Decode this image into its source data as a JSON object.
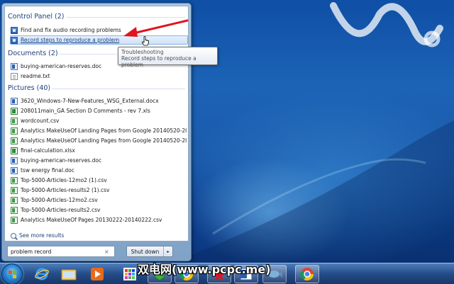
{
  "colors": {
    "accent": "#1e3f79",
    "selection": "#cde2f8",
    "annotation_arrow": "#e0141e"
  },
  "start_menu": {
    "groups": [
      {
        "header": "Control Panel (2)",
        "items": [
          {
            "label": "Find and fix audio recording problems",
            "icon": "control-panel-icon",
            "selected": false
          },
          {
            "label": "Record steps to reproduce a problem",
            "icon": "control-panel-icon",
            "selected": true
          }
        ]
      },
      {
        "header": "Documents (2)",
        "items": [
          {
            "label": "buying-american-reserves.doc",
            "icon": "word-doc-icon"
          },
          {
            "label": "readme.txt",
            "icon": "text-file-icon"
          }
        ]
      },
      {
        "header": "Pictures (40)",
        "items": [
          {
            "label": "3620_Windows-7-New-Features_WSG_External.docx",
            "icon": "word-doc-icon"
          },
          {
            "label": "208011main_GA Section D Comments - rev 7.xls",
            "icon": "excel-icon"
          },
          {
            "label": "wordcount.csv",
            "icon": "csv-icon"
          },
          {
            "label": "Analytics MakeUseOf Landing Pages from Google 20140520-20...",
            "icon": "csv-icon"
          },
          {
            "label": "Analytics MakeUseOf Landing Pages from Google 20140520-20...",
            "icon": "csv-icon"
          },
          {
            "label": "final-calculation.xlsx",
            "icon": "excel-icon"
          },
          {
            "label": "buying-american-reserves.doc",
            "icon": "word-doc-icon"
          },
          {
            "label": "tsw energy final.doc",
            "icon": "word-doc-icon"
          },
          {
            "label": "Top-5000-Articles-12mo2 (1).csv",
            "icon": "csv-icon"
          },
          {
            "label": "Top-5000-Articles-results2 (1).csv",
            "icon": "csv-icon"
          },
          {
            "label": "Top-5000-Articles-12mo2.csv",
            "icon": "csv-icon"
          },
          {
            "label": "Top-5000-Articles-results2.csv",
            "icon": "csv-icon"
          },
          {
            "label": "Analytics MakeUseOf Pages 20130222-20140222.csv",
            "icon": "csv-icon"
          }
        ]
      }
    ],
    "see_more": "See more results",
    "search": {
      "value": "problem record",
      "clear_glyph": "×"
    },
    "shutdown": {
      "label": "Shut down",
      "arrow_glyph": "▸"
    }
  },
  "tooltip": {
    "title": "Troubleshooting",
    "description": "Record steps to reproduce a problem"
  },
  "taskbar": {
    "items": [
      {
        "name": "start-orb",
        "icon": "windows-logo-icon"
      },
      {
        "name": "internet-explorer",
        "icon": "ie-icon"
      },
      {
        "name": "file-explorer",
        "icon": "folder-icon"
      },
      {
        "name": "media-player",
        "icon": "media-player-icon"
      },
      {
        "name": "app-grid",
        "icon": "grid-app-icon"
      },
      {
        "name": "green-app",
        "icon": "green-shield-icon"
      },
      {
        "name": "chrome-pinned",
        "icon": "chrome-icon"
      },
      {
        "name": "red-app",
        "icon": "red-star-icon"
      },
      {
        "name": "word",
        "icon": "word-icon"
      },
      {
        "name": "fish-app",
        "icon": "fish-icon"
      },
      {
        "name": "chrome-active",
        "icon": "chrome-icon"
      }
    ]
  },
  "watermark": "双电网(www.pcpc.me)"
}
